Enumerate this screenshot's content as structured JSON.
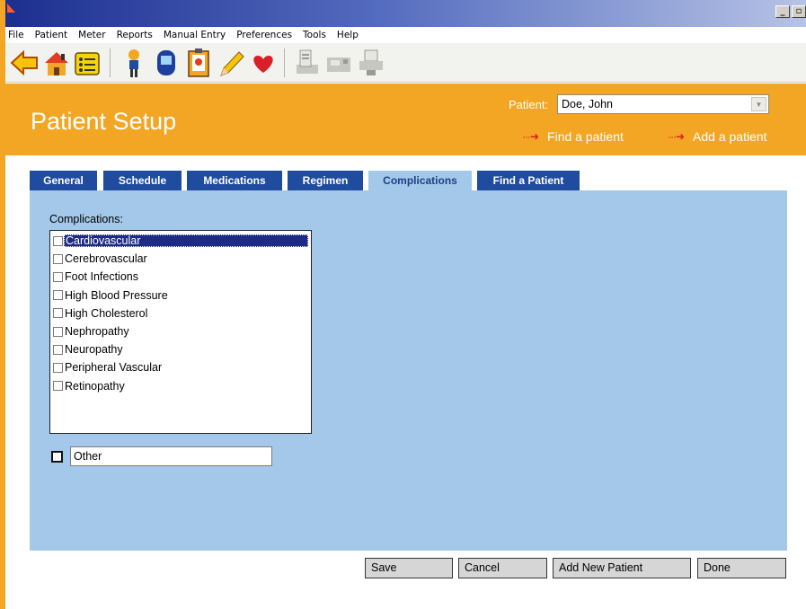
{
  "window": {
    "minimize": "_",
    "restore": "▫"
  },
  "menu": [
    "File",
    "Patient",
    "Meter",
    "Reports",
    "Manual Entry",
    "Preferences",
    "Tools",
    "Help"
  ],
  "toolbar": {
    "icons": [
      "back-arrow-icon",
      "home-icon",
      "list-icon",
      "person-icon",
      "meter-device-icon",
      "clipboard-icon",
      "pencil-icon",
      "heart-icon",
      "download-device-icon",
      "pump-device-icon",
      "printer-device-icon"
    ]
  },
  "header": {
    "title": "Patient Setup",
    "patient_label": "Patient:",
    "patient_value": "Doe, John",
    "find_link": "Find a patient",
    "add_link": "Add a patient",
    "link_arrow": "···➜"
  },
  "tabs": [
    {
      "label": "General"
    },
    {
      "label": "Schedule"
    },
    {
      "label": "Medications"
    },
    {
      "label": "Regimen"
    },
    {
      "label": "Complications"
    },
    {
      "label": "Find a Patient"
    }
  ],
  "active_tab": "Complications",
  "complications": {
    "label": "Complications:",
    "items": [
      {
        "label": "Cardiovascular",
        "checked": false,
        "selected": true
      },
      {
        "label": "Cerebrovascular",
        "checked": false
      },
      {
        "label": "Foot Infections",
        "checked": false
      },
      {
        "label": "High Blood Pressure",
        "checked": false
      },
      {
        "label": "High Cholesterol",
        "checked": false
      },
      {
        "label": "Nephropathy",
        "checked": false
      },
      {
        "label": "Neuropathy",
        "checked": false
      },
      {
        "label": "Peripheral Vascular",
        "checked": false
      },
      {
        "label": "Retinopathy",
        "checked": false
      }
    ],
    "other_value": "Other"
  },
  "buttons": {
    "save": "Save",
    "cancel": "Cancel",
    "add_new_patient": "Add New Patient",
    "done": "Done"
  },
  "colors": {
    "header_orange": "#f3a624",
    "tab_blue": "#1f4c9f",
    "panel_blue": "#a3c8ea",
    "selection_blue": "#1d2a86"
  }
}
